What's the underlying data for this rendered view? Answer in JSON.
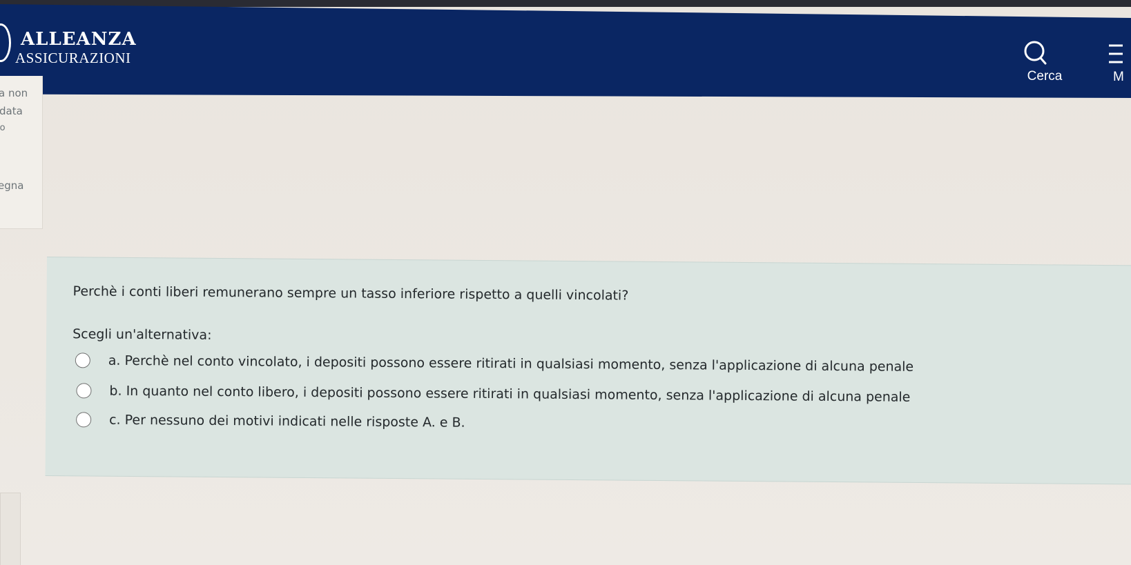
{
  "header": {
    "logo_line1": "ALLEANZA",
    "logo_line2": "ASSICURAZIONI",
    "search_label": "Cerca",
    "menu_label": "M"
  },
  "sidebar": {
    "lines": [
      "a non",
      "data",
      "io",
      "egna"
    ]
  },
  "quiz": {
    "question": "Perchè i conti liberi remunerano sempre un tasso inferiore rispetto a quelli vincolati?",
    "prompt": "Scegli un'alternativa:",
    "options": [
      {
        "text": "a. Perchè nel conto vincolato, i depositi possono essere ritirati in qualsiasi momento, senza l'applicazione di alcuna penale",
        "selected": false
      },
      {
        "text": "b. In quanto nel conto libero, i depositi possono essere ritirati in qualsiasi momento, senza l'applicazione di alcuna penale",
        "selected": false
      },
      {
        "text": "c. Per nessuno dei motivi indicati nelle risposte A. e B.",
        "selected": false
      }
    ]
  },
  "colors": {
    "header_bg": "#0a2663",
    "question_bg": "#dbe5e1",
    "page_bg": "#ebe6df"
  }
}
